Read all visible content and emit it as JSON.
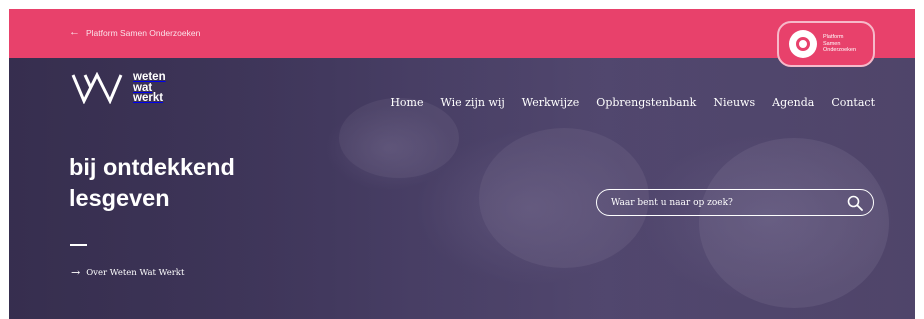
{
  "topbar": {
    "back_link_label": "Platform Samen Onderzoeken",
    "back_icon": "arrow-left-icon"
  },
  "platform_badge": {
    "line1": "Platform",
    "line2": "Samen",
    "line3": "Onderzoeken"
  },
  "logo": {
    "line1": "weten",
    "line2": "wat",
    "line3": "werkt"
  },
  "nav": {
    "items": [
      {
        "label": "Home"
      },
      {
        "label": "Wie zijn wij"
      },
      {
        "label": "Werkwijze"
      },
      {
        "label": "Opbrengstenbank"
      },
      {
        "label": "Nieuws"
      },
      {
        "label": "Agenda"
      },
      {
        "label": "Contact"
      }
    ]
  },
  "search": {
    "placeholder": "Waar bent u naar op zoek?",
    "icon": "search-icon"
  },
  "hero": {
    "headline_line1": "bij ontdekkend",
    "headline_line2": "lesgeven",
    "about_link_label": "Over Weten Wat Werkt",
    "about_icon": "arrow-right-icon"
  },
  "colors": {
    "accent": "#e8416b",
    "hero_overlay": "#4a4068",
    "text": "#ffffff"
  }
}
